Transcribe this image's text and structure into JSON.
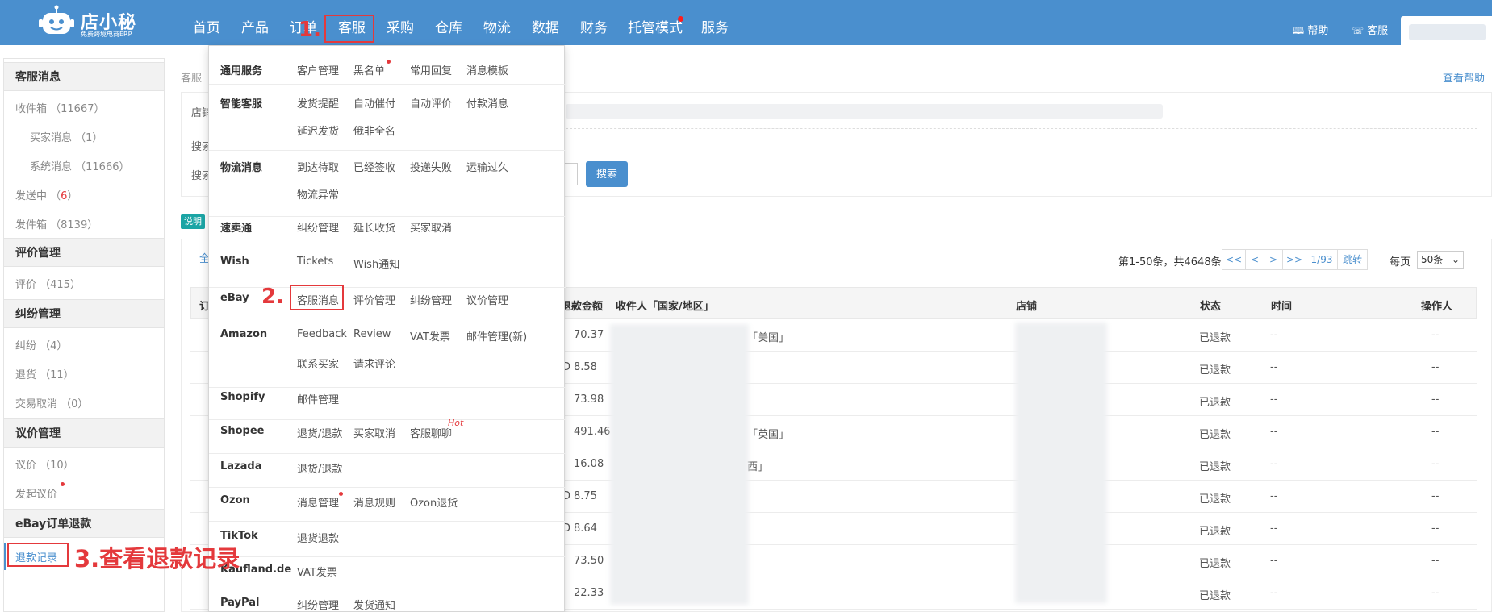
{
  "brand": {
    "name": "店小秘",
    "tagline": "免费跨境电商ERP"
  },
  "nav": [
    "首页",
    "产品",
    "订单",
    "客服",
    "采购",
    "仓库",
    "物流",
    "数据",
    "财务",
    "托管模式",
    "服务"
  ],
  "top_right": {
    "help": "帮助",
    "service": "客服"
  },
  "sidebar": {
    "sections": [
      {
        "title": "客服消息",
        "items": [
          "收件箱 （11667）",
          "买家消息 （1）",
          "系统消息 （11666）",
          "发送中 （6）",
          "发件箱 （8139）"
        ]
      },
      {
        "title": "评价管理",
        "items": [
          "评价 （415）"
        ]
      },
      {
        "title": "纠纷管理",
        "items": [
          "纠纷 （4）",
          "退货 （11）",
          "交易取消 （0）"
        ]
      },
      {
        "title": "议价管理",
        "items": [
          "议价 （10）",
          "发起议价"
        ]
      },
      {
        "title": "eBay订单退款",
        "items": [
          "退款记录"
        ]
      }
    ]
  },
  "breadcrumb": "客服",
  "view_help": "查看帮助",
  "filters": {
    "shop_label": "店铺",
    "search_label1": "搜索",
    "search_label2": "搜索",
    "search_button": "搜索",
    "note_tag": "说明"
  },
  "tab_all": "全",
  "pager": {
    "range": "第1-50条，共4648条",
    "first": "<<",
    "prev": "<",
    "next": ">",
    "last": ">>",
    "page": "1/93",
    "jump": "跳转",
    "per_page_label": "每页",
    "per_page_value": "50条"
  },
  "table": {
    "headers": [
      "订",
      "退款金额",
      "收件人「国家/地区」",
      "店铺",
      "状态",
      "时间",
      "操作人"
    ],
    "rows": [
      {
        "amount": "70.37",
        "prefix": "",
        "country": "「美国」",
        "status": "已退款",
        "time": "--",
        "operator": "--"
      },
      {
        "amount": "8.58",
        "prefix": "D",
        "country": "",
        "status": "已退款",
        "time": "--",
        "operator": "--"
      },
      {
        "amount": "73.98",
        "prefix": "",
        "country": "",
        "status": "已退款",
        "time": "--",
        "operator": "--"
      },
      {
        "amount": "491.46",
        "prefix": "",
        "country": "「英国」",
        "status": "已退款",
        "time": "--",
        "operator": "--"
      },
      {
        "amount": "16.08",
        "prefix": "",
        "country": "西」",
        "status": "已退款",
        "time": "--",
        "operator": "--"
      },
      {
        "amount": "8.75",
        "prefix": "D",
        "country": "",
        "status": "已退款",
        "time": "--",
        "operator": "--"
      },
      {
        "amount": "8.64",
        "prefix": "D",
        "country": "",
        "status": "已退款",
        "time": "--",
        "operator": "--"
      },
      {
        "amount": "73.50",
        "prefix": "",
        "country": "",
        "status": "已退款",
        "time": "--",
        "operator": "--"
      },
      {
        "amount": "22.33",
        "prefix": "",
        "country": "",
        "status": "已退款",
        "time": "--",
        "operator": "--"
      }
    ]
  },
  "dropdown": [
    {
      "head": "通用服务",
      "links": [
        "客户管理",
        "黑名单",
        "常用回复",
        "消息模板"
      ]
    },
    {
      "head": "智能客服",
      "links": [
        "发货提醒",
        "自动催付",
        "自动评价",
        "付款消息",
        "延迟发货",
        "俄非全名"
      ]
    },
    {
      "head": "物流消息",
      "links": [
        "到达待取",
        "已经签收",
        "投递失败",
        "运输过久",
        "物流异常"
      ]
    },
    {
      "head": "速卖通",
      "links": [
        "纠纷管理",
        "延长收货",
        "买家取消"
      ]
    },
    {
      "head": "Wish",
      "links": [
        "Tickets",
        "Wish通知"
      ]
    },
    {
      "head": "eBay",
      "links": [
        "客服消息",
        "评价管理",
        "纠纷管理",
        "议价管理"
      ]
    },
    {
      "head": "Amazon",
      "links": [
        "Feedback",
        "Review",
        "VAT发票",
        "邮件管理(新)",
        "联系买家",
        "请求评论"
      ]
    },
    {
      "head": "Shopify",
      "links": [
        "邮件管理"
      ]
    },
    {
      "head": "Shopee",
      "links": [
        "退货/退款",
        "买家取消",
        "客服聊聊"
      ]
    },
    {
      "head": "Lazada",
      "links": [
        "退货/退款"
      ]
    },
    {
      "head": "Ozon",
      "links": [
        "消息管理",
        "消息规则",
        "Ozon退货"
      ]
    },
    {
      "head": "TikTok",
      "links": [
        "退货退款"
      ]
    },
    {
      "head": "Kaufland.de",
      "links": [
        "VAT发票"
      ]
    },
    {
      "head": "PayPal",
      "links": [
        "纠纷管理",
        "发货通知"
      ]
    }
  ],
  "hot_label": "Hot",
  "annotations": {
    "step1": "1.",
    "step2": "2.",
    "step3": "3.查看退款记录"
  },
  "colors": {
    "topbar": "#4a8fce",
    "accent": "#4a8fce",
    "annotation": "#e4393c"
  }
}
